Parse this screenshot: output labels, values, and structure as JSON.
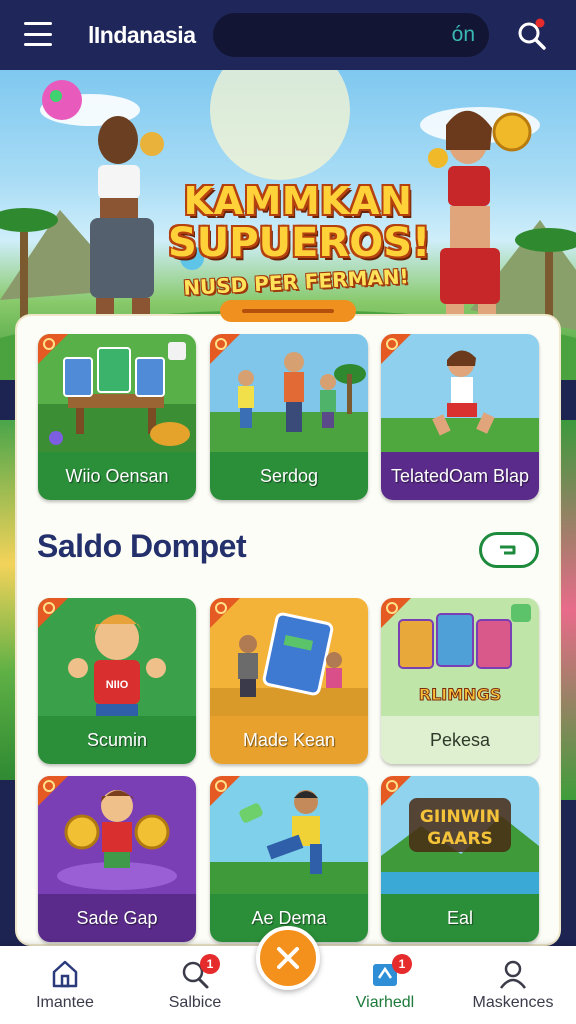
{
  "header": {
    "brand": "lIndanasia",
    "search_value": "ón"
  },
  "hero": {
    "title_line1": "KAMMKAN",
    "title_line2": "SUPUEROS!",
    "subtitle": "NUSD PER FERMAN!"
  },
  "section": {
    "title": "Saldo Dompet"
  },
  "games_top": [
    {
      "label": "Wiio Oensan"
    },
    {
      "label": "Serdog"
    },
    {
      "label": "TelatedOam Blap"
    }
  ],
  "games_mid": [
    {
      "label": "Scumin"
    },
    {
      "label": "Made Kean"
    },
    {
      "label": "Pekesa"
    }
  ],
  "games_bottom": [
    {
      "label": "Sade Gap"
    },
    {
      "label": "Ae Dema"
    },
    {
      "label": "Eal"
    }
  ],
  "card_art_text": {
    "mid_1_shirt": "NIIO",
    "mid_3_banner": "RLIMNGS",
    "bottom_3_logo_l1": "GIINWIN",
    "bottom_3_logo_l2": "GAARS"
  },
  "nav": {
    "items": [
      {
        "label": "Imantee",
        "icon": "home-icon",
        "badge": ""
      },
      {
        "label": "Salbice",
        "icon": "search-icon",
        "badge": "1"
      },
      {
        "label": "Viarhedl",
        "icon": "wallet-icon",
        "badge": "1"
      },
      {
        "label": "Maskences",
        "icon": "user-icon",
        "badge": ""
      }
    ]
  },
  "colors": {
    "header_bg": "#1f2659",
    "accent_orange": "#f4901c",
    "card_green": "#2b8f3a",
    "card_purple": "#5a2b8a",
    "title_navy": "#23306b"
  }
}
